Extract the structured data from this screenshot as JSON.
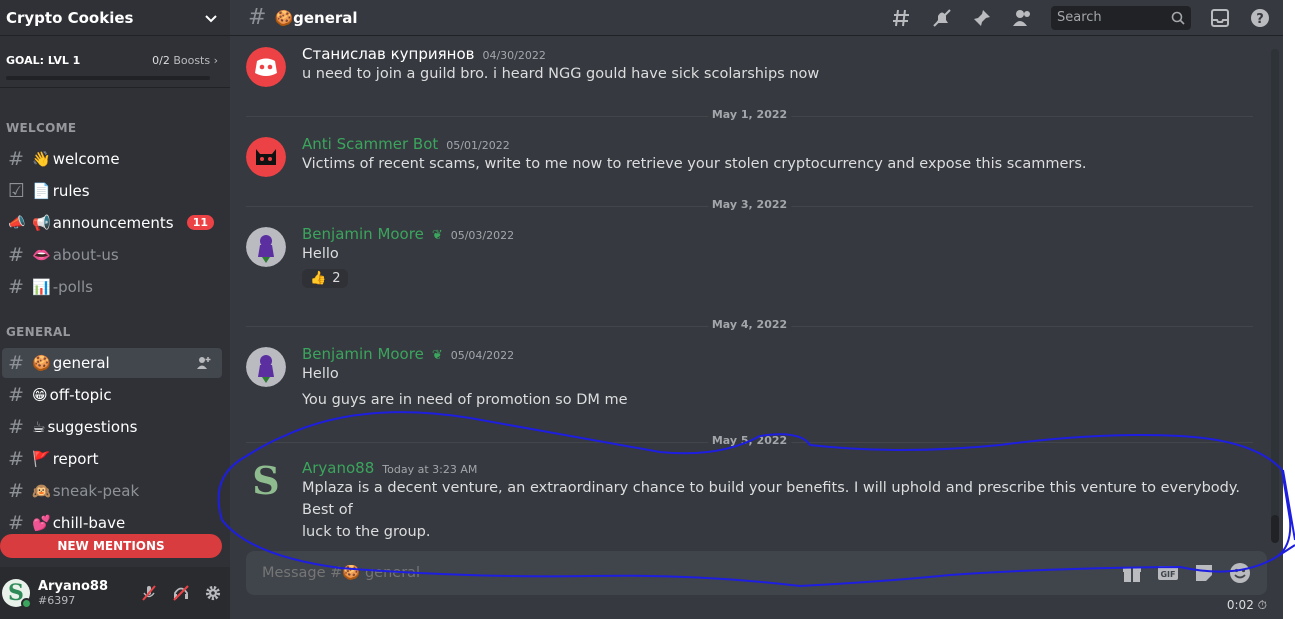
{
  "server": {
    "name": "Crypto Cookies"
  },
  "goal": {
    "label": "GOAL: LVL 1",
    "count": "0/2",
    "boosts_label": "Boosts",
    "progress": 0
  },
  "categories": {
    "welcome": "WELCOME",
    "general": "GENERAL"
  },
  "channels": {
    "welcome": {
      "emoji": "👋",
      "name": "welcome"
    },
    "rules": {
      "emoji": "📄",
      "name": "rules"
    },
    "announcements": {
      "emoji": "📢",
      "name": "announcements",
      "badge": "11"
    },
    "about_us": {
      "emoji": "👄",
      "name": "about-us"
    },
    "polls": {
      "emoji": "📊",
      "name": "-polls"
    },
    "general": {
      "emoji": "🍪",
      "name": "general"
    },
    "off_topic": {
      "emoji": "😁",
      "name": "off-topic"
    },
    "suggestions": {
      "emoji": "☕",
      "name": "suggestions"
    },
    "report": {
      "emoji": "🚩",
      "name": "report"
    },
    "sneak_peak": {
      "emoji": "🙉",
      "name": "sneak-peak"
    },
    "chill_bave": {
      "emoji": "💕",
      "name": "chill-bave"
    }
  },
  "new_mentions": "NEW MENTIONS",
  "user": {
    "name": "Aryano88",
    "tag": "#6397",
    "avatar_letter": "S"
  },
  "header": {
    "channel_emoji": "🍪",
    "channel_name": "general",
    "search_placeholder": "Search"
  },
  "dividers": [
    "May 1, 2022",
    "May 3, 2022",
    "May 4, 2022",
    "May 5, 2022"
  ],
  "messages": [
    {
      "author": "Станислав куприянов",
      "timestamp": "04/30/2022",
      "author_color": "#ffffff",
      "lines": [
        "u need to join a guild bro. i heard NGG gould have sick scolarships now"
      ]
    },
    {
      "author": "Anti Scammer Bot",
      "timestamp": "05/01/2022",
      "author_color": "#3ba55d",
      "lines": [
        "Victims of recent scams, write to me now to retrieve your stolen cryptocurrency and expose this scammers."
      ]
    },
    {
      "author": "Benjamin Moore",
      "timestamp": "05/03/2022",
      "author_color": "#3ba55d",
      "lines": [
        "Hello"
      ],
      "reaction": {
        "emoji": "👍",
        "count": "2"
      }
    },
    {
      "author": "Benjamin Moore",
      "timestamp": "05/04/2022",
      "author_color": "#3ba55d",
      "lines": [
        "Hello",
        "You guys are in need of promotion so DM me"
      ]
    },
    {
      "author": "Aryano88",
      "timestamp": "Today at 3:23 AM",
      "author_color": "#3ba55d",
      "lines": [
        "Mplaza is a decent venture, an extraordinary chance to build your benefits. I will uphold and prescribe this venture to everybody. Best of",
        "luck to the group."
      ]
    }
  ],
  "composer": {
    "placeholder": "Message #🍪 general"
  },
  "timer": "0:02 ⏱",
  "colors": {
    "sidebar": "#2f3136",
    "main": "#36393f",
    "accent_green": "#3ba55d",
    "mention_red": "#d83c3e",
    "annotation_blue": "#1e1ee0"
  },
  "icons": [
    "threads-icon",
    "bell-mute-icon",
    "pin-icon",
    "members-icon",
    "search-icon",
    "inbox-icon",
    "help-icon",
    "gift-icon",
    "gif-icon",
    "sticker-icon",
    "emoji-icon",
    "mic-mute-icon",
    "headset-mute-icon",
    "gear-icon"
  ]
}
